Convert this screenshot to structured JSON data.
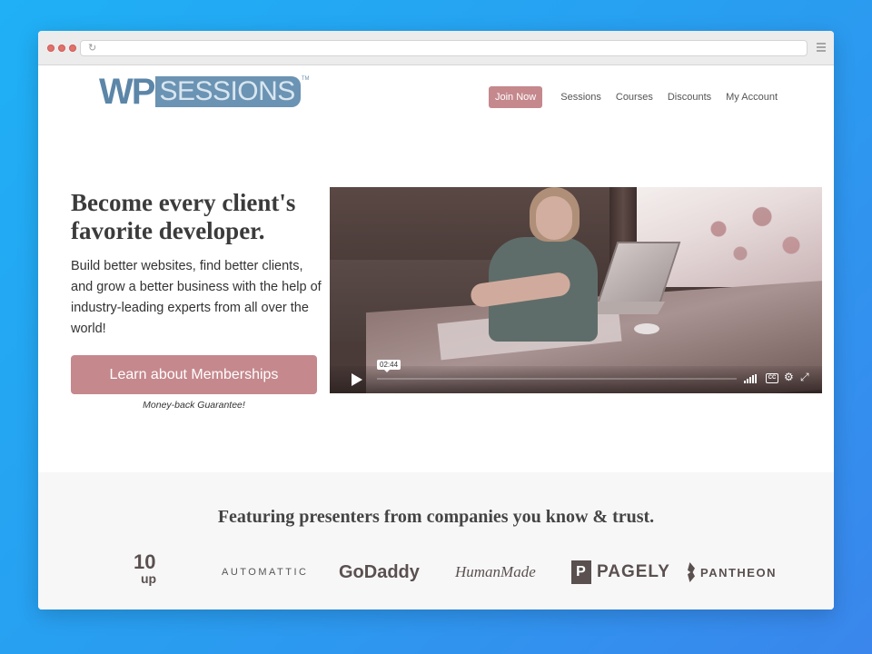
{
  "logo": {
    "wp": "WP",
    "sessions": "SESSIONS",
    "tm": "TM"
  },
  "nav": {
    "join": "Join Now",
    "items": [
      "Sessions",
      "Courses",
      "Discounts",
      "My Account"
    ]
  },
  "hero": {
    "title": "Become every client's favorite developer.",
    "body": "Build better websites, find better clients, and grow a better business with the help of industry-leading experts from all over the world!",
    "cta": "Learn about Memberships",
    "guarantee": "Money-back Guarantee!"
  },
  "video": {
    "duration": "02:44",
    "cc": "CC"
  },
  "companies": {
    "title": "Featuring presenters from companies you know & trust.",
    "logos": [
      "10 up",
      "AUTOMATTIC",
      "GoDaddy",
      "HumanMade",
      "PAGELY",
      "PANTHEON"
    ],
    "tenup_top": "10",
    "tenup_bottom": "up",
    "pagely_mark": "P"
  },
  "colors": {
    "accent": "#c5888d",
    "logo_blue": "#5c86a8",
    "background": "#1fb0f5"
  }
}
